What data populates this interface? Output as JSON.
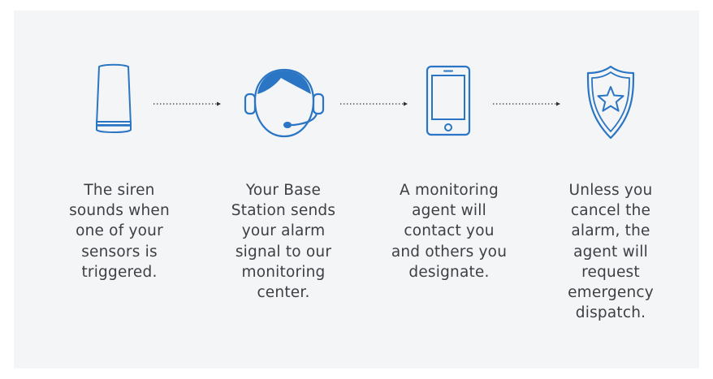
{
  "colors": {
    "background": "#f4f5f6",
    "icon_stroke": "#2a75c4",
    "icon_fill": "#2a75c4",
    "connector": "#2b2d31",
    "text": "#3c4045"
  },
  "steps": [
    {
      "icon": "siren-icon",
      "lines": [
        "The siren",
        "sounds when",
        "one of your",
        "sensors is",
        "triggered."
      ]
    },
    {
      "icon": "headset-agent-icon",
      "lines": [
        "Your Base",
        "Station sends",
        "your alarm",
        "signal to our",
        "monitoring",
        "center."
      ]
    },
    {
      "icon": "smartphone-icon",
      "lines": [
        "A monitoring",
        "agent will",
        "contact you",
        "and others you",
        "designate."
      ]
    },
    {
      "icon": "police-badge-icon",
      "lines": [
        "Unless you",
        "cancel the",
        "alarm, the",
        "agent will",
        "request",
        "emergency",
        "dispatch."
      ]
    }
  ]
}
